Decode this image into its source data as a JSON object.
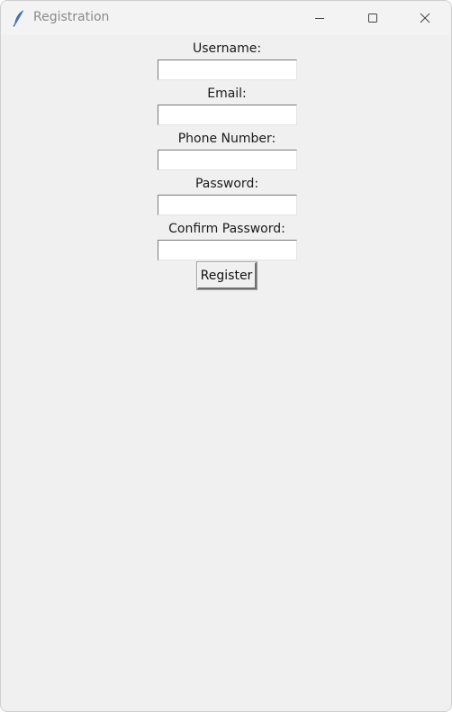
{
  "window": {
    "title": "Registration",
    "icon": "feather-icon",
    "controls": {
      "minimize": "minimize-icon",
      "maximize": "maximize-icon",
      "close": "close-icon"
    }
  },
  "form": {
    "username_label": "Username:",
    "username_value": "",
    "email_label": "Email:",
    "email_value": "",
    "phone_label": "Phone Number:",
    "phone_value": "",
    "password_label": "Password:",
    "password_value": "",
    "confirm_label": "Confirm Password:",
    "confirm_value": "",
    "register_label": "Register"
  },
  "colors": {
    "window_bg": "#f0f0f0",
    "title_text": "#8a8a8a",
    "input_bg": "#ffffff"
  }
}
